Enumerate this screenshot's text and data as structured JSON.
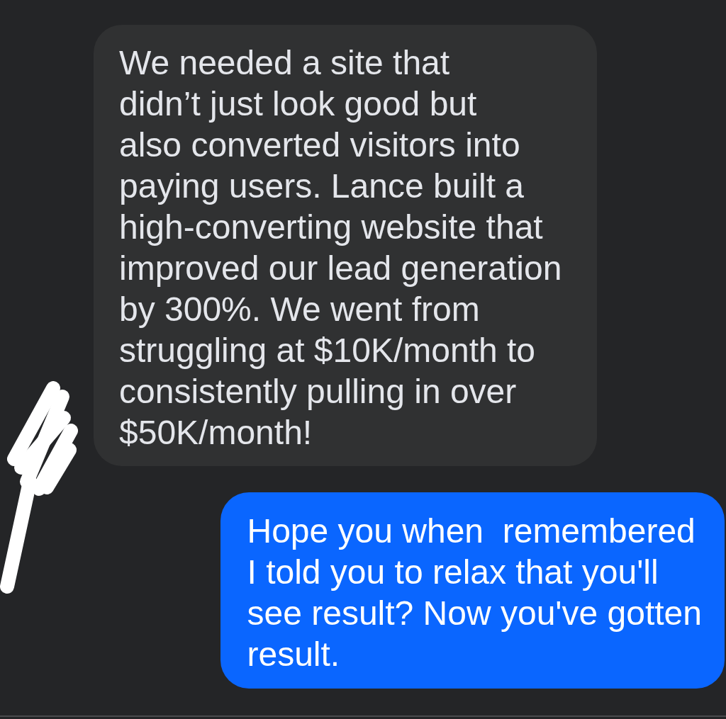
{
  "messages": [
    {
      "kind": "received",
      "text": "We needed a site that\ndidn’t just look good but\nalso converted visitors into\npaying users. Lance built a\nhigh-converting website that\nimproved our lead generation\nby 300%. We went from\nstruggling at $10K/month to\nconsistently pulling in over\n$50K/month!"
    },
    {
      "kind": "sent",
      "text": "Hope you when  remembered\nI told you to relax that you'll\nsee result? Now you've gotten\nresult."
    }
  ]
}
